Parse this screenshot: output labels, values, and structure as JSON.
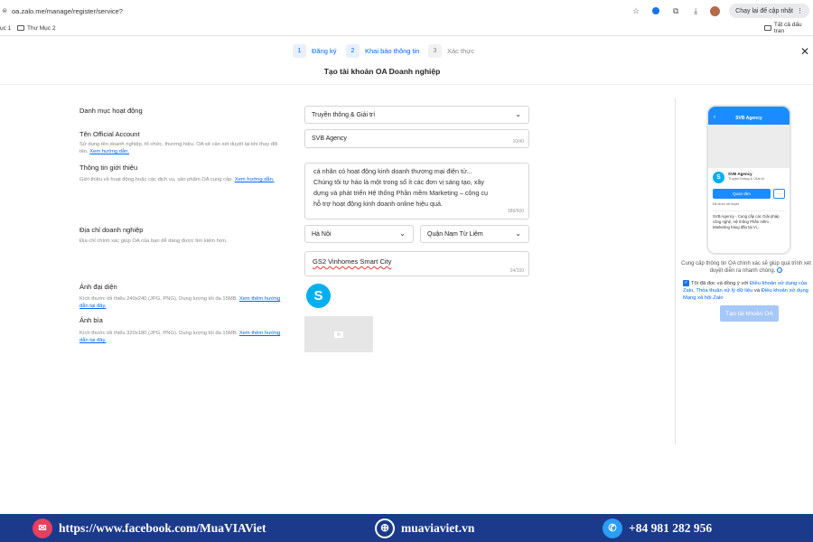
{
  "browser": {
    "url": "oa.zalo.me/manage/register/service?",
    "update_label": "Chạy lại để cập nhật",
    "bookmark_partial": "ục 1",
    "bookmark_folder": "Thư Mục 2",
    "all_bookmarks": "Tất cả dấu tran"
  },
  "stepper": {
    "steps": [
      {
        "num": "1",
        "label": "Đăng ký"
      },
      {
        "num": "2",
        "label": "Khai báo thông tin"
      },
      {
        "num": "3",
        "label": "Xác thực"
      }
    ]
  },
  "page": {
    "title": "Tạo tài khoản OA Doanh nghiệp"
  },
  "form": {
    "category": {
      "label": "Danh mục hoạt động",
      "value": "Truyền thông & Giải trí"
    },
    "official_name": {
      "label": "Tên Official Account",
      "desc": "Sử dụng tên doanh nghiệp, tổ chức, thương hiệu. OA sẽ cần xét duyệt lại khi thay đổi tên.",
      "link": "Xem hướng dẫn.",
      "value": "SVB Agency",
      "count": "10/40"
    },
    "intro": {
      "label": "Thông tin giới thiệu",
      "desc": "Giới thiệu về hoạt động hoặc các dịch vụ, sản phẩm OA cung cấp.",
      "link": "Xem hướng dẫn.",
      "lines": [
        "cá nhân có hoạt động kinh doanh thương mại điện tử...",
        "Chúng tôi tự hào là một trong số ít các đơn vị sáng tạo, xây",
        "dựng và phát triển Hệ thống Phần mềm Marketing – công cụ",
        "hỗ trợ hoạt động kinh doanh online hiệu quả."
      ],
      "count": "389/500"
    },
    "address": {
      "label": "Địa chỉ doanh nghiệp",
      "desc": "Địa chỉ chính xác giúp OA của bạn dễ dàng được tìm kiếm hơn.",
      "city": "Hà Nội",
      "district": "Quận Nam Từ Liêm",
      "street": "GS2 Vinhomes Smart City",
      "count": "24/100"
    },
    "avatar": {
      "label": "Ảnh đại diện",
      "desc": "Kích thước tối thiểu 240x240 (JPG, PNG). Dung lượng tối đa 15MB.",
      "link": "Xem thêm hướng dẫn tại đây.",
      "logo": "S"
    },
    "cover": {
      "label": "Ảnh bìa",
      "desc": "Kích thước tối thiểu 320x180 (JPG, PNG). Dung lượng tối đa 15MB.",
      "link": "Xem thêm hướng dẫn tại đây."
    }
  },
  "preview": {
    "header": "SVB Agency",
    "name": "SVB Agency",
    "category": "Truyền thông & Giải trí",
    "follow_button": "Quan tâm",
    "more": "···",
    "warning": "Đã được xét duyệt",
    "description": "SVB Agency - Cung cấp các Giải pháp công nghệ, Hệ thống Phần mềm Marketing hàng đầu tại Vi...",
    "note": "Cung cấp thông tin OA chính xác sẽ giúp quá trình xét duyệt diễn ra nhanh chóng.",
    "agree_prefix": "Tôi đã đọc và đồng ý với",
    "agree_terms": "Điều khoản sử dụng của Zalo",
    "agree_mid": ",",
    "agree_policy": "Thỏa thuận xử lý dữ liệu",
    "agree_and": "và",
    "agree_social": "Điều khoản sử dụng Mạng xã hội Zalo",
    "create_button": "Tạo tài khoản OA"
  },
  "footer": {
    "facebook": "https://www.facebook.com/MuaVIAViet",
    "website": "muaviaviet.vn",
    "phone": "+84 981 282 956"
  },
  "colors": {
    "accent": "#0068ff",
    "footer_bg": "#1c3a8b"
  }
}
